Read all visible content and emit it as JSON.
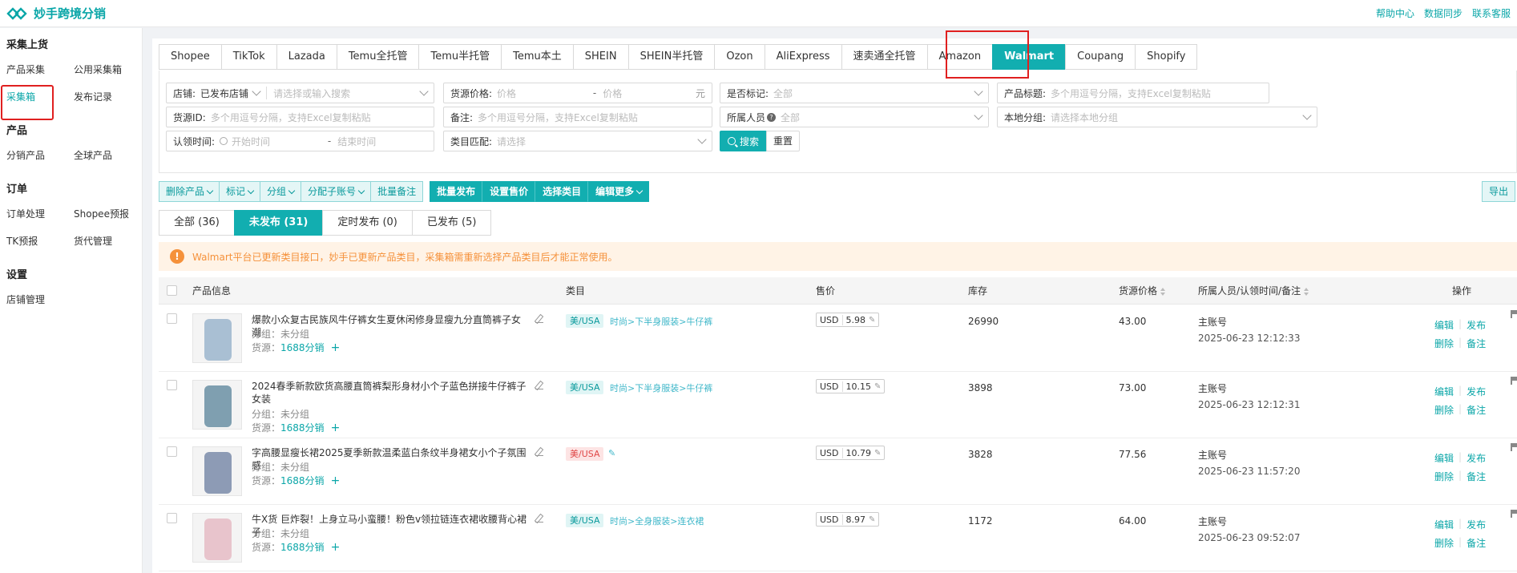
{
  "brand": {
    "name": "妙手跨境分销"
  },
  "top_links": [
    "帮助中心",
    "数据同步",
    "联系客服"
  ],
  "sidebar": {
    "sections": [
      {
        "title": "采集上货",
        "items": [
          "产品采集",
          "公用采集箱",
          "采集箱",
          "发布记录"
        ]
      },
      {
        "title": "产品",
        "items": [
          "分销产品",
          "全球产品"
        ]
      },
      {
        "title": "订单",
        "items": [
          "订单处理",
          "Shopee预报",
          "TK预报",
          "货代管理"
        ]
      },
      {
        "title": "设置",
        "items": [
          "店铺管理"
        ]
      }
    ]
  },
  "platform_tabs": [
    "Shopee",
    "TikTok",
    "Lazada",
    "Temu全托管",
    "Temu半托管",
    "Temu本土",
    "SHEIN",
    "SHEIN半托管",
    "Ozon",
    "AliExpress",
    "速卖通全托管",
    "Amazon",
    "Walmart",
    "Coupang",
    "Shopify"
  ],
  "filters": {
    "store_label": "店铺:",
    "store_value": "已发布店铺",
    "store_ph": "请选择或输入搜索",
    "price_label": "货源价格:",
    "price_from_ph": "价格",
    "price_to_ph": "价格",
    "price_unit": "元",
    "marked_label": "是否标记:",
    "marked_value": "全部",
    "title_label": "产品标题:",
    "title_ph": "多个用逗号分隔，支持Excel复制粘贴",
    "srcid_label": "货源ID:",
    "srcid_ph": "多个用逗号分隔，支持Excel复制粘贴",
    "note_label": "备注:",
    "note_ph": "多个用逗号分隔，支持Excel复制粘贴",
    "owner_label": "所属人员",
    "owner_value": "全部",
    "group_label": "本地分组:",
    "group_ph": "请选择本地分组",
    "claim_label": "认领时间:",
    "claim_start_ph": "开始时间",
    "claim_end_ph": "结束时间",
    "cat_label": "类目匹配:",
    "cat_ph": "请选择",
    "search_btn": "搜索",
    "reset_btn": "重置"
  },
  "actions": {
    "group1": [
      "删除产品",
      "标记",
      "分组",
      "分配子账号",
      "批量备注"
    ],
    "group2": [
      "批量发布",
      "设置售价",
      "选择类目",
      "编辑更多"
    ],
    "export": "导出"
  },
  "status_tabs": [
    "全部 (36)",
    "未发布 (31)",
    "定时发布 (0)",
    "已发布 (5)"
  ],
  "alert": "Walmart平台已更新类目接口，妙手已更新产品类目，采集箱需重新选择产品类目后才能正常使用。",
  "table": {
    "headers": [
      "产品信息",
      "类目",
      "售价",
      "库存",
      "货源价格",
      "所属人员/认领时间/备注",
      "操作"
    ],
    "rows": [
      {
        "title": "爆款小众复古民族风牛仔裤女生夏休闲修身显瘦九分直筒裤子女潮",
        "group": "分组：未分组",
        "source_label": "货源：",
        "source": "1688分销",
        "region": "美/USA",
        "category": "时尚>下半身服装>牛仔裤",
        "currency": "USD",
        "price": "5.98",
        "stock": "26990",
        "src_price": "43.00",
        "owner": "主账号",
        "time": "2025-06-23 12:12:33",
        "thumb_color": "#a9bfd3"
      },
      {
        "title": "2024春季新款欧货高腰直筒裤梨形身材小个子蓝色拼接牛仔裤子女装",
        "group": "分组：未分组",
        "source_label": "货源：",
        "source": "1688分销",
        "region": "美/USA",
        "category": "时尚>下半身服装>牛仔裤",
        "currency": "USD",
        "price": "10.15",
        "stock": "3898",
        "src_price": "73.00",
        "owner": "主账号",
        "time": "2025-06-23 12:12:31",
        "thumb_color": "#7f9fb0"
      },
      {
        "title": "字高腰显瘦长裙2025夏季新款温柔蓝白条纹半身裙女小个子氛围感",
        "group": "分组：未分组",
        "source_label": "货源：",
        "source": "1688分销",
        "region": "美/USA",
        "category": "",
        "currency": "USD",
        "price": "10.79",
        "stock": "3828",
        "src_price": "77.56",
        "owner": "主账号",
        "time": "2025-06-23 11:57:20",
        "thumb_color": "#8d9bb5"
      },
      {
        "title": "牛X货 巨炸裂！上身立马小蛮腰！粉色v领拉链连衣裙收腰背心裙子",
        "group": "分组：未分组",
        "source_label": "货源：",
        "source": "1688分销",
        "region": "美/USA",
        "category": "时尚>全身服装>连衣裙",
        "currency": "USD",
        "price": "8.97",
        "stock": "1172",
        "src_price": "64.00",
        "owner": "主账号",
        "time": "2025-06-23 09:52:07",
        "thumb_color": "#e8c4cc"
      }
    ],
    "ops": [
      "编辑",
      "发布",
      "删除",
      "备注"
    ]
  }
}
